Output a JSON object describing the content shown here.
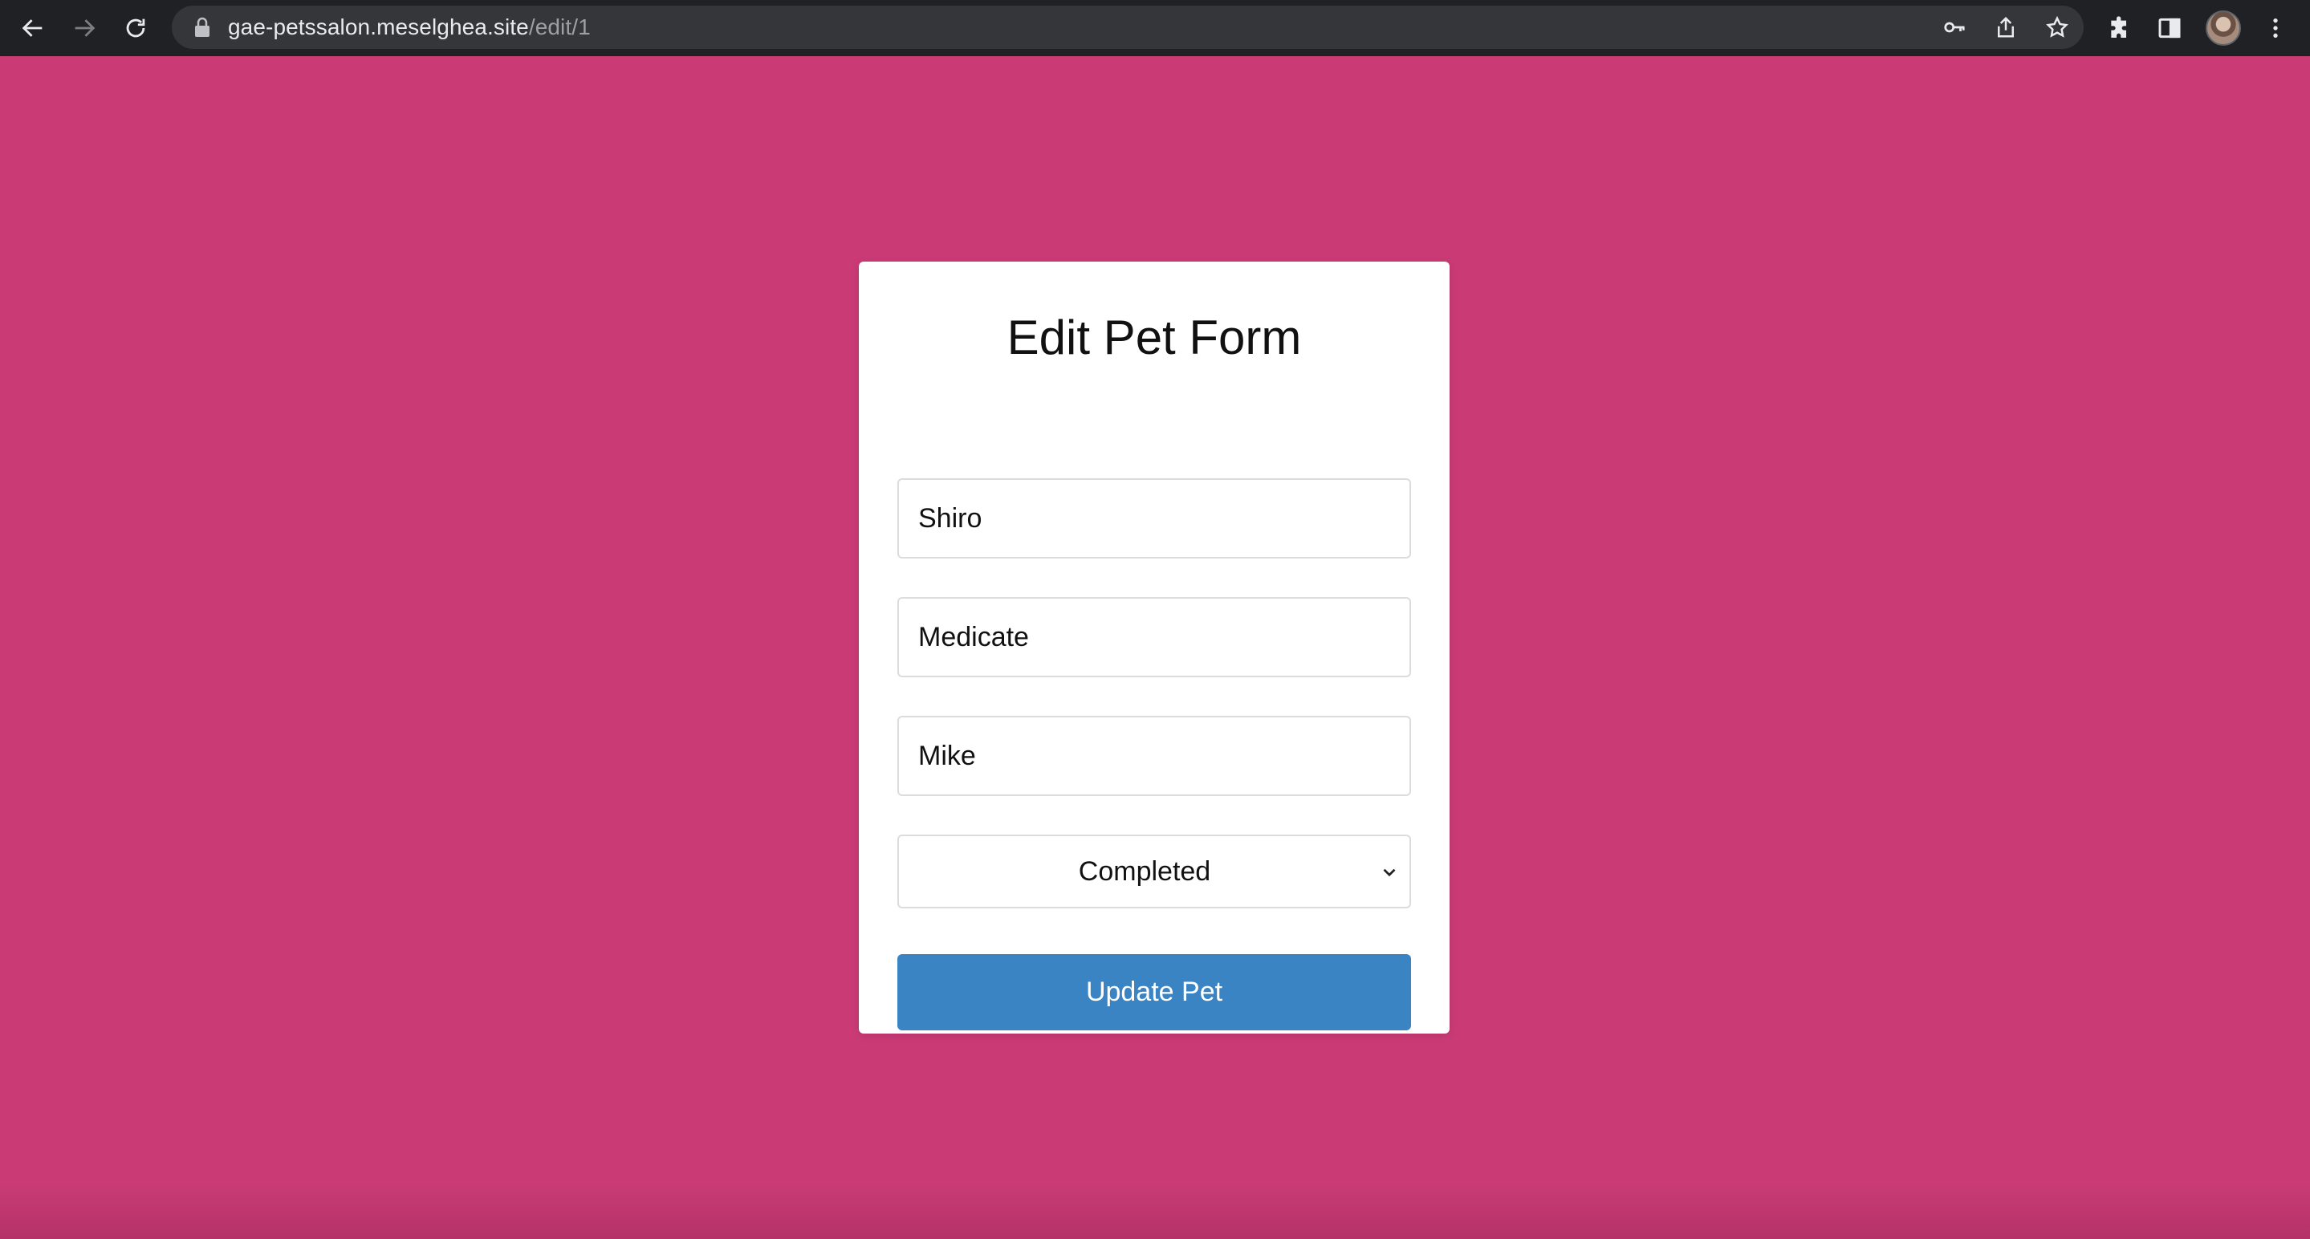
{
  "browser": {
    "url_host": "gae-petssalon.meselghea.site",
    "url_path": "/edit/1",
    "icons": {
      "back": "arrow-left-icon",
      "forward": "arrow-right-icon",
      "reload": "reload-icon",
      "lock": "lock-icon",
      "password_key": "key-icon",
      "share": "share-icon",
      "bookmark": "star-icon",
      "extensions": "puzzle-icon",
      "side_panel": "side-panel-icon",
      "profile": "avatar",
      "menu": "kebab-menu-icon"
    }
  },
  "page": {
    "background_color": "#ca3b75",
    "form": {
      "title": "Edit Pet Form",
      "fields": [
        {
          "name": "pet-name",
          "value": "Shiro"
        },
        {
          "name": "pet-service",
          "value": "Medicate"
        },
        {
          "name": "owner-name",
          "value": "Mike"
        }
      ],
      "status_select": {
        "selected": "Completed"
      },
      "submit_label": "Update Pet",
      "submit_color": "#3a84c4"
    }
  }
}
